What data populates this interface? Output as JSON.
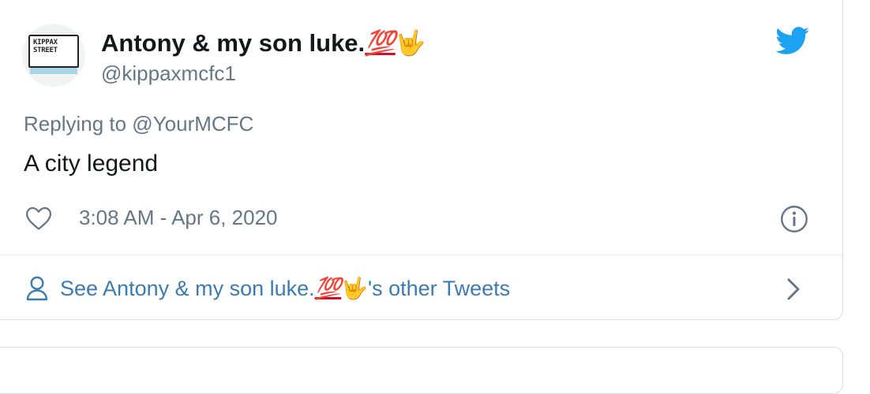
{
  "tweet": {
    "author": {
      "display_name": "Antony & my son luke.",
      "display_emoji_100": "💯",
      "display_emoji_hand": "🤟",
      "handle": "@kippaxmcfc1",
      "avatar_sign_text": "KIPPAX STREET"
    },
    "replying_to": "Replying to @YourMCFC",
    "text": "A city legend",
    "timestamp": "3:08 AM - Apr 6, 2020"
  },
  "footer": {
    "see_prefix": "See Antony & my son luke.",
    "see_emoji_100": "💯",
    "see_emoji_hand": "🤟",
    "see_suffix": "'s other Tweets"
  },
  "icons": {
    "brand": "twitter-bird-icon",
    "like": "heart-icon",
    "info": "info-icon",
    "profile": "person-icon",
    "chevron": "chevron-right-icon"
  },
  "colors": {
    "twitter_blue": "#1da1f2",
    "link_blue": "#3b7bb3",
    "secondary_text": "#657786",
    "primary_text": "#14171a",
    "emoji_red": "#d0112b",
    "emoji_yellow": "#f4b818"
  }
}
